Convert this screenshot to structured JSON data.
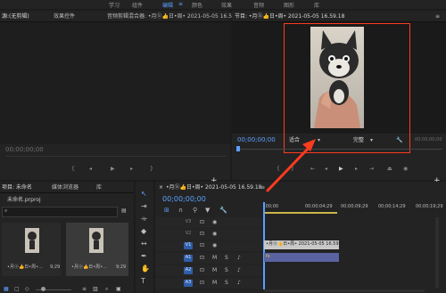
{
  "workspace_tabs": [
    "学习",
    "组件",
    "编辑",
    "颜色",
    "效果",
    "音频",
    "图形",
    "库"
  ],
  "source_panel": {
    "tabs": [
      "源:(无剪辑)",
      "效果控件",
      "音频剪辑混合器: •月ⓑ👍日•周• 2021-05-05 16.59..."
    ],
    "timecode": "00;00;00;00"
  },
  "program_panel": {
    "title": "节目: •月ⓑ👍日•周• 2021-05-05 16.59.18",
    "timecode": "00;00;00;00",
    "fit_label": "适合",
    "quality_label": "完整",
    "right_timecode": "00;00;00;00"
  },
  "project_panel": {
    "tabs": [
      "项目: 未命名",
      "媒体浏览器",
      "库"
    ],
    "file_name": "未命名.prproj",
    "thumbnails": [
      {
        "label": "•月ⓑ👍日•周•...",
        "duration": "9;29"
      },
      {
        "label": "•月ⓑ👍日•周•...",
        "duration": "9;29"
      }
    ]
  },
  "timeline": {
    "sequence_tab": "•月ⓑ👍日•周• 2021-05-05 16.59.18",
    "timecode": "00;00;00;00",
    "ruler": [
      ";00;00",
      "00;00;04;29",
      "00;00;09;29",
      "00;00;14;29",
      "00;00;19;29"
    ],
    "video_tracks": [
      "V3",
      "V2",
      "V1"
    ],
    "audio_tracks": [
      "A1",
      "A2",
      "A3"
    ],
    "video_clip_label": "•月ⓑ👍日•周• 2021-05-05 16.59.18",
    "audio_clip_label": "fx",
    "track_mute": "M",
    "track_solo": "S"
  },
  "tools": [
    "selection-tool",
    "track-select-tool",
    "ripple-edit-tool",
    "razor-tool",
    "slip-tool",
    "pen-tool",
    "hand-tool",
    "type-tool"
  ],
  "colors": {
    "accent": "#5aa0ff",
    "annotation": "#ff3b1f",
    "video_clip": "#c8c8c8",
    "audio_clip": "#5a63a0"
  }
}
